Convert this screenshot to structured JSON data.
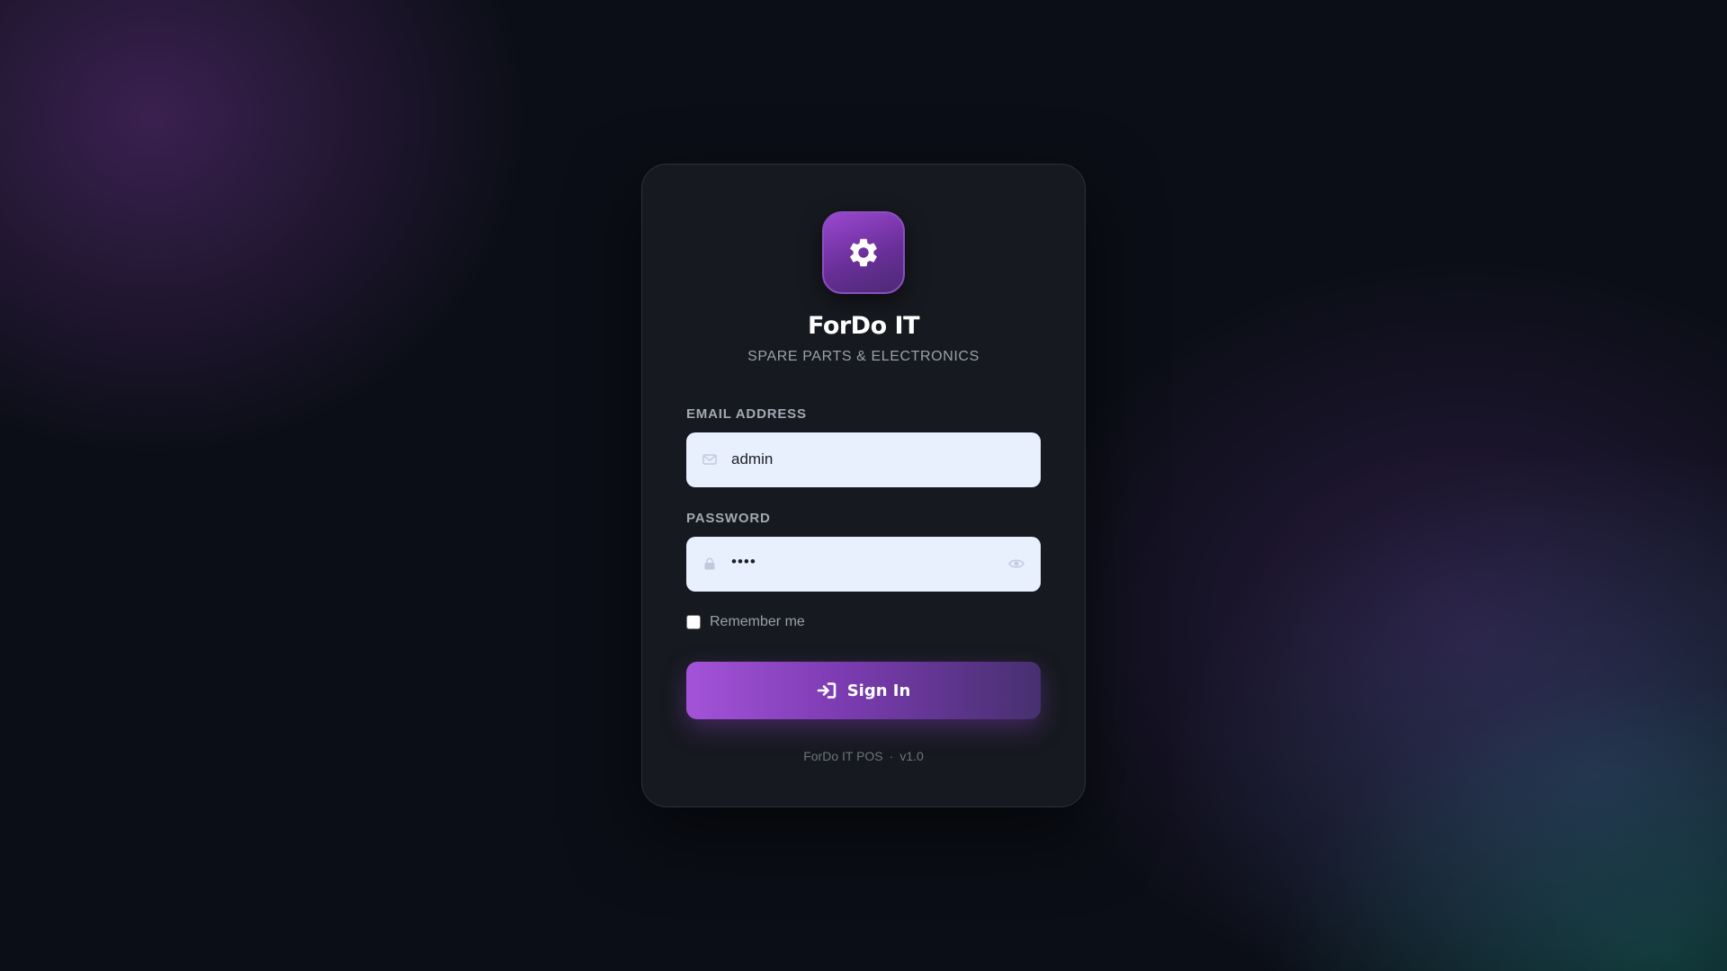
{
  "brand": {
    "title": "ForDo IT",
    "subtitle": "SPARE PARTS & ELECTRONICS",
    "logo_icon": "gear-icon",
    "accent": "#8b45c4"
  },
  "form": {
    "email": {
      "label": "EMAIL ADDRESS",
      "value": "admin",
      "icon": "envelope-icon"
    },
    "password": {
      "label": "PASSWORD",
      "masked_value": "••••",
      "icon": "lock-icon",
      "toggle_icon": "eye-icon"
    },
    "remember": {
      "label": "Remember me",
      "checked": false
    },
    "submit": {
      "label": "Sign In",
      "icon": "sign-in-icon"
    }
  },
  "footer": {
    "product": "ForDo IT POS",
    "separator": "·",
    "version": "v1.0"
  }
}
